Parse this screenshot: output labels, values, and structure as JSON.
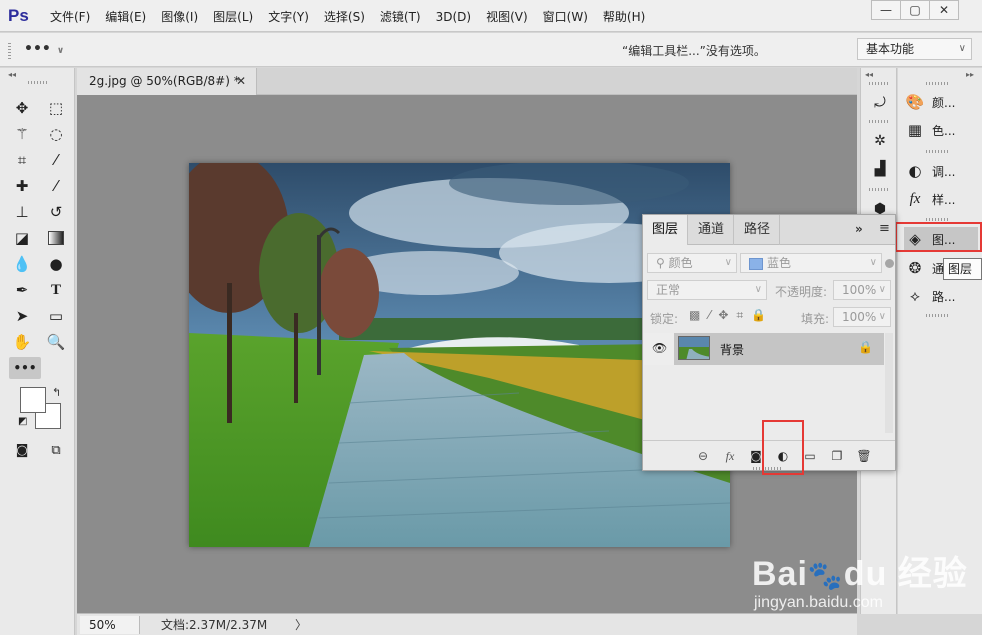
{
  "app": {
    "logo": "Ps"
  },
  "menu": [
    "文件(F)",
    "编辑(E)",
    "图像(I)",
    "图层(L)",
    "文字(Y)",
    "选择(S)",
    "滤镜(T)",
    "3D(D)",
    "视图(V)",
    "窗口(W)",
    "帮助(H)"
  ],
  "window_controls": {
    "minimize": "—",
    "restore": "▢",
    "close": "✕"
  },
  "options_bar": {
    "more": "•••",
    "message": "“编辑工具栏...”没有选项。",
    "workspace": "基本功能"
  },
  "document": {
    "tab_title": "2g.jpg @ 50%(RGB/8#) *",
    "tab_close": "✕",
    "zoom": "50%",
    "doc_info": "文档:2.37M/2.37M",
    "status_arrow": "〉"
  },
  "colors": {
    "foreground": "#ffffff",
    "background": "#ffffff",
    "highlight": "#e53935"
  },
  "right_panel": {
    "items": [
      {
        "icon": "color-palette-icon",
        "label": "颜..."
      },
      {
        "icon": "swatches-icon",
        "label": "色..."
      },
      {
        "icon": "adjustments-icon",
        "label": "调..."
      },
      {
        "icon": "styles-icon",
        "label": "样..."
      },
      {
        "icon": "layers-icon",
        "label": "图..."
      },
      {
        "icon": "channels-icon",
        "label": "通..."
      },
      {
        "icon": "paths-icon",
        "label": "路..."
      }
    ],
    "tooltip": "图层"
  },
  "layers_panel": {
    "tabs": [
      "图层",
      "通道",
      "路径"
    ],
    "filter_kind": "颜色",
    "filter_value": "蓝色",
    "blend_mode": "正常",
    "opacity_label": "不透明度:",
    "opacity_value": "100%",
    "lock_label": "锁定:",
    "fill_label": "填充:",
    "fill_value": "100%",
    "layer_name": "背景"
  }
}
